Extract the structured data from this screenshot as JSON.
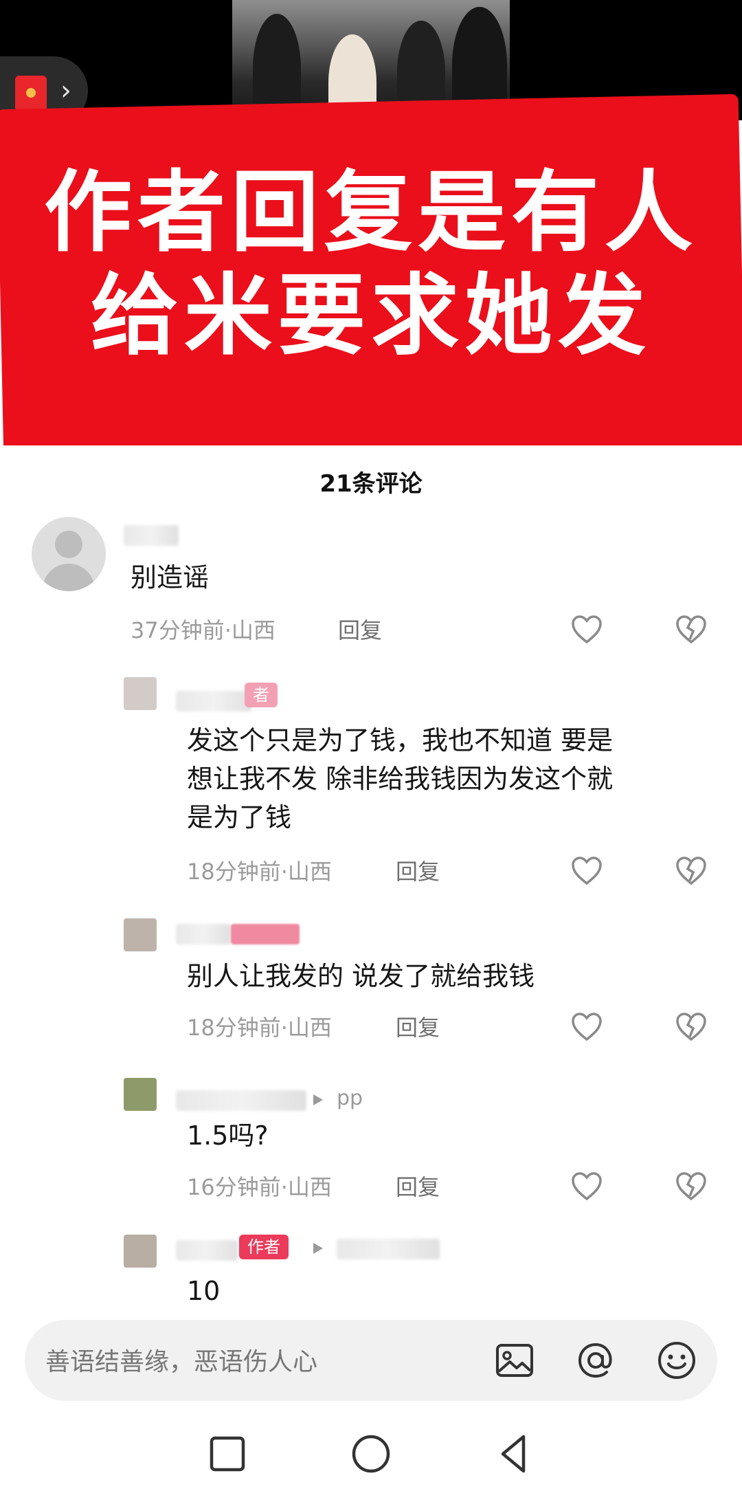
{
  "banner": {
    "line1": "作者回复是有人",
    "line2": "给米要求她发"
  },
  "comments_header": "21条评论",
  "comments": [
    {
      "text": "别造谣",
      "time_location": "37分钟前·山西",
      "reply_label": "回复"
    },
    {
      "author_tag": "者",
      "text_lines": [
        "发这个只是为了钱，我也不知道 要是",
        "想让我不发 除非给我钱因为发这个就",
        "是为了钱"
      ],
      "time_location": "18分钟前·山西",
      "reply_label": "回复"
    },
    {
      "text": "别人让我发的 说发了就给我钱",
      "time_location": "18分钟前·山西",
      "reply_label": "回复"
    },
    {
      "reply_to": "pp",
      "text": "1.5吗?",
      "time_location": "16分钟前·山西",
      "reply_label": "回复"
    },
    {
      "author_tag": "作者",
      "text": "10"
    }
  ],
  "input": {
    "placeholder": "善语结善缘，恶语伤人心"
  },
  "icons": {
    "like": "heart-icon",
    "dislike": "broken-heart-icon",
    "image": "image-icon",
    "mention": "at-icon",
    "emoji": "smiley-icon",
    "nav_recent": "square-icon",
    "nav_home": "circle-icon",
    "nav_back": "triangle-back-icon",
    "redpacket": "red-packet-icon"
  },
  "colors": {
    "banner_red": "#ea0f1b",
    "author_tag": "#ec3a5a"
  }
}
